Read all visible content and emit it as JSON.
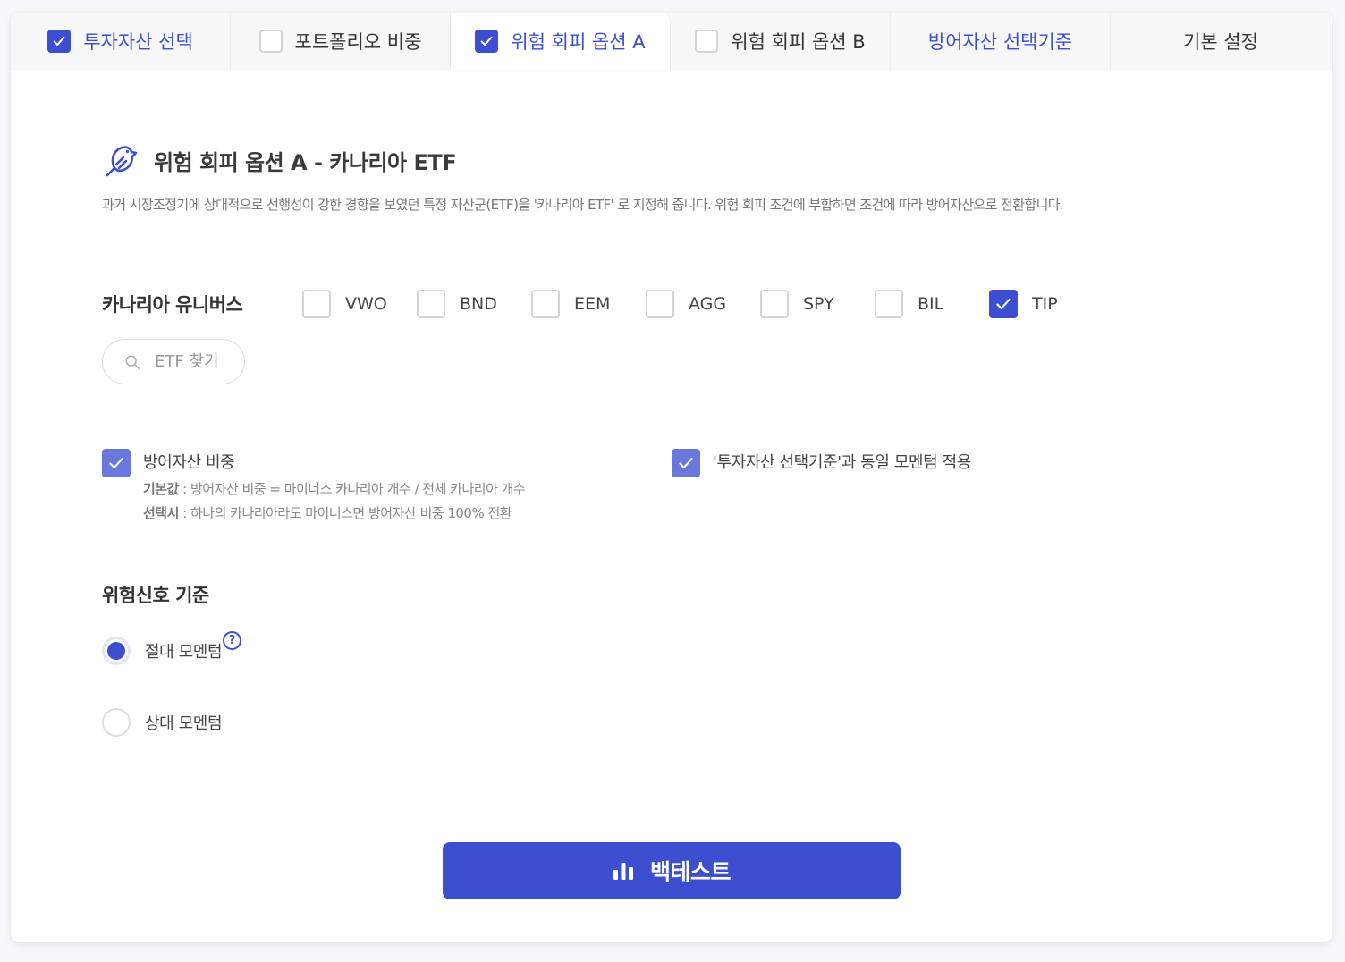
{
  "tabs": [
    {
      "label": "투자자산 선택",
      "checkbox": true,
      "checked": true
    },
    {
      "label": "포트폴리오 비중",
      "checkbox": true,
      "checked": false
    },
    {
      "label": "위험 회피 옵션 A",
      "checkbox": true,
      "checked": true
    },
    {
      "label": "위험 회피 옵션 B",
      "checkbox": true,
      "checked": false
    },
    {
      "label": "방어자산 선택기준",
      "checkbox": false
    },
    {
      "label": "기본 설정",
      "checkbox": false
    }
  ],
  "section": {
    "icon": "bird-icon",
    "title": "위험 회피 옵션 A - 카나리아 ETF",
    "description": "과거 시장조정기에 상대적으로 선행성이 강한 경향을 보였던 특정 자산군(ETF)을 '카나리아 ETF' 로 지정해 줍니다. 위험 회피 조건에 부합하면 조건에 따라 방어자산으로 전환합니다."
  },
  "universe": {
    "label": "카나리아 유니버스",
    "etfs": [
      {
        "ticker": "VWO",
        "checked": false
      },
      {
        "ticker": "BND",
        "checked": false
      },
      {
        "ticker": "EEM",
        "checked": false
      },
      {
        "ticker": "AGG",
        "checked": false
      },
      {
        "ticker": "SPY",
        "checked": false
      },
      {
        "ticker": "BIL",
        "checked": false
      },
      {
        "ticker": "TIP",
        "checked": true
      }
    ],
    "search_placeholder": "ETF 찾기"
  },
  "defense_weight": {
    "label": "방어자산 비중",
    "checked": true,
    "default_key": "기본값",
    "default_value": " : 방어자산 비중 = 마이너스 카나리아 개수 / 전체 카나리아 개수",
    "selected_key": "선택시",
    "selected_value": " : 하나의 카나리아라도 마이너스면 방어자산 비중 100% 전환"
  },
  "same_momentum": {
    "label": "'투자자산 선택기준'과 동일 모멘텀 적용",
    "checked": true
  },
  "risk_signal": {
    "title": "위험신호 기준",
    "options": [
      {
        "label": "절대 모멘텀",
        "selected": true,
        "help": "?"
      },
      {
        "label": "상대 모멘텀",
        "selected": false
      }
    ]
  },
  "backtest_button": {
    "label": "백테스트",
    "icon": "bar-chart-icon"
  },
  "colors": {
    "accent": "#3b4fd0",
    "accent_soft": "#6b78db",
    "page_bg": "#f6f7fb"
  }
}
